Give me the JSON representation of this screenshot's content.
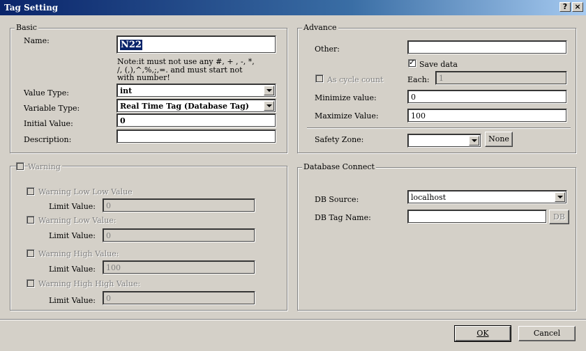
{
  "window": {
    "title": "Tag Setting",
    "help_btn": "?",
    "close_btn": "×"
  },
  "basic": {
    "legend": "Basic",
    "name_label": "Name:",
    "name_value": "N22",
    "note_line1": "Note:it must not use any #, + , -, *,",
    "note_line2": "/, (,),^,%,;,=. and must start not",
    "note_line3": "with number!",
    "value_type_label": "Value Type:",
    "value_type": "int",
    "variable_type_label": "Variable Type:",
    "variable_type": "Real Time Tag (Database Tag)",
    "initial_label": "Initial Value:",
    "initial_value": "0",
    "description_label": "Description:",
    "description_value": ""
  },
  "advance": {
    "legend": "Advance",
    "other_label": "Other:",
    "other_value": "",
    "save_data_label": "Save data",
    "cycle_label": "As cycle count",
    "each_label": "Each:",
    "each_value": "1",
    "min_label": "Minimize value:",
    "min_value": "0",
    "max_label": "Maximize Value:",
    "max_value": "100",
    "safety_label": "Safety Zone:",
    "safety_value": "",
    "none_btn": "None"
  },
  "warning": {
    "legend": "Warning",
    "low_low": "Warning Low Low Value",
    "low": "Warning Low Value:",
    "high": "Warning High Value:",
    "high_high": "Warning High High Value:",
    "limit_label": "Limit Value:",
    "ll_value": "0",
    "l_value": "0",
    "h_value": "100",
    "hh_value": "0"
  },
  "db": {
    "legend": "Database Connect",
    "source_label": "DB Source:",
    "source_value": "localhost",
    "tagname_label": "DB Tag Name:",
    "tagname_value": "",
    "db_btn": "DB"
  },
  "footer": {
    "ok": "OK",
    "cancel": "Cancel"
  }
}
